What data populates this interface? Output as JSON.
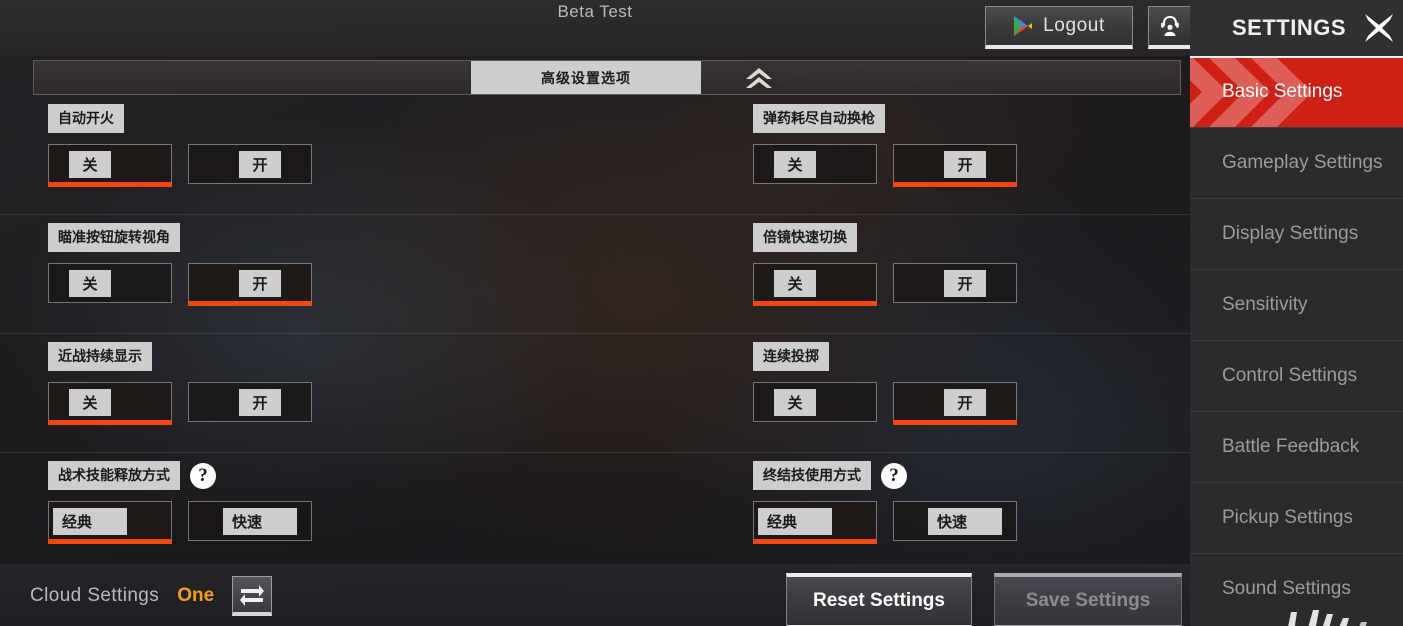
{
  "header": {
    "title": "Beta Test",
    "logout_label": "Logout",
    "play_icon": "google-play-triangle-icon",
    "avatar_icon": "headset-support-icon"
  },
  "advanced_bar": {
    "chip_label": "高级设置选项",
    "collapse_icon": "double-chevron-up-icon"
  },
  "settings_rows": [
    {
      "left": {
        "label": "自动开火",
        "has_help": false,
        "options": [
          {
            "label": "关",
            "selected": true
          },
          {
            "label": "开",
            "selected": false
          }
        ]
      },
      "right": {
        "label": "弹药耗尽自动换枪",
        "has_help": false,
        "options": [
          {
            "label": "关",
            "selected": false
          },
          {
            "label": "开",
            "selected": true
          }
        ]
      }
    },
    {
      "left": {
        "label": "瞄准按钮旋转视角",
        "has_help": false,
        "options": [
          {
            "label": "关",
            "selected": false
          },
          {
            "label": "开",
            "selected": true
          }
        ]
      },
      "right": {
        "label": "倍镜快速切换",
        "has_help": false,
        "options": [
          {
            "label": "关",
            "selected": true
          },
          {
            "label": "开",
            "selected": false
          }
        ]
      }
    },
    {
      "left": {
        "label": "近战持续显示",
        "has_help": false,
        "options": [
          {
            "label": "关",
            "selected": true
          },
          {
            "label": "开",
            "selected": false
          }
        ]
      },
      "right": {
        "label": "连续投掷",
        "has_help": false,
        "options": [
          {
            "label": "关",
            "selected": false
          },
          {
            "label": "开",
            "selected": true
          }
        ]
      }
    },
    {
      "left": {
        "label": "战术技能释放方式",
        "has_help": true,
        "help_label": "?",
        "options": [
          {
            "label": "经典",
            "selected": true
          },
          {
            "label": "快速",
            "selected": false
          }
        ]
      },
      "right": {
        "label": "终结技使用方式",
        "has_help": true,
        "help_label": "?",
        "options": [
          {
            "label": "经典",
            "selected": true
          },
          {
            "label": "快速",
            "selected": false
          }
        ]
      }
    }
  ],
  "footer": {
    "cloud_label": "Cloud Settings",
    "cloud_slot": "One",
    "swap_icon": "swap-arrows-icon",
    "reset_label": "Reset Settings",
    "save_label": "Save Settings",
    "save_disabled": true
  },
  "sidebar": {
    "title": "SETTINGS",
    "close_icon": "close-x-icon",
    "items": [
      {
        "label": "Basic Settings",
        "active": true
      },
      {
        "label": "Gameplay Settings",
        "active": false
      },
      {
        "label": "Display Settings",
        "active": false
      },
      {
        "label": "Sensitivity",
        "active": false
      },
      {
        "label": "Control Settings",
        "active": false
      },
      {
        "label": "Battle Feedback",
        "active": false
      },
      {
        "label": "Pickup Settings",
        "active": false
      },
      {
        "label": "Sound Settings",
        "active": false
      }
    ]
  },
  "colors": {
    "accent_orange": "#f3470e",
    "accent_red": "#cf2016",
    "gold": "#f2a117",
    "chip_gray": "#cdcdcd"
  }
}
